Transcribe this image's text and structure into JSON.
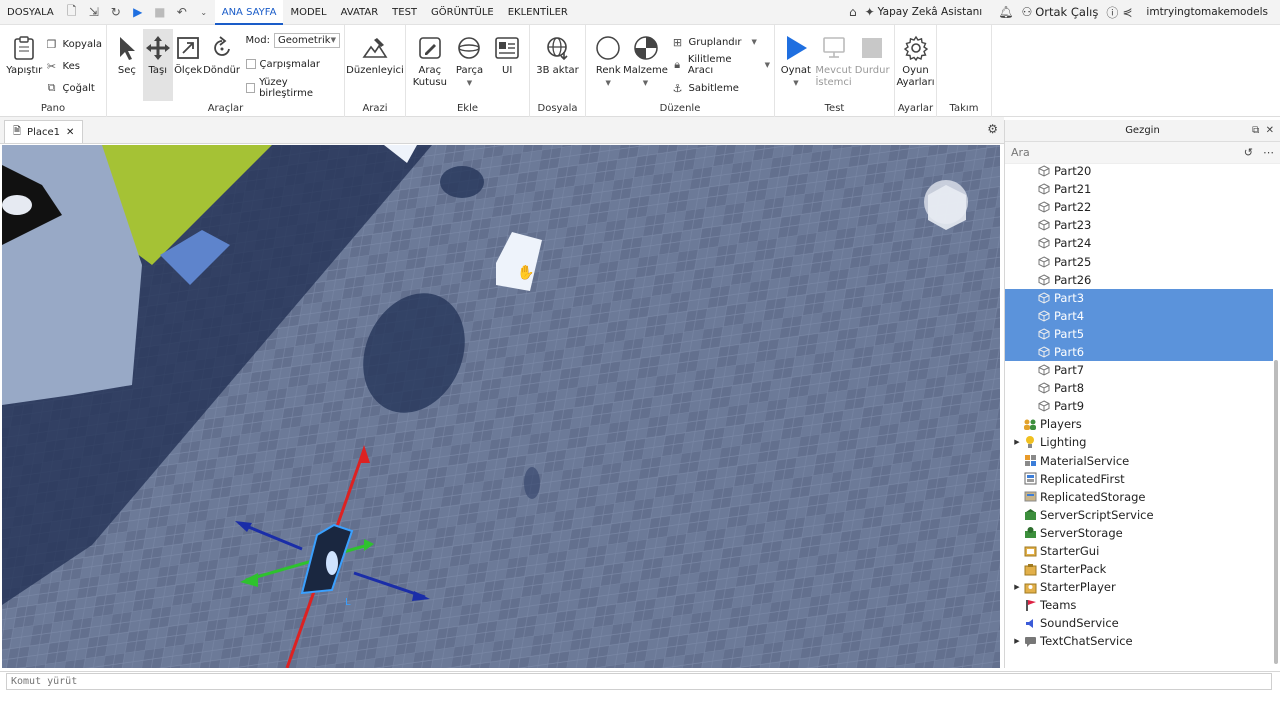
{
  "menu": {
    "file": "DOSYALA",
    "tabs": [
      "ANA SAYFA",
      "MODEL",
      "AVATAR",
      "TEST",
      "GÖRÜNTÜLE",
      "EKLENTİLER"
    ],
    "active_tab": "ANA SAYFA",
    "ai_assistant": "Yapay Zekâ Asistanı",
    "collaborate": "Ortak Çalış",
    "user": "imtryingtomakemodels"
  },
  "ribbon": {
    "pano": {
      "label": "Pano",
      "paste": "Yapıştır",
      "copy": "Kopyala",
      "cut": "Kes",
      "duplicate": "Çoğalt"
    },
    "tools": {
      "label": "Araçlar",
      "select": "Seç",
      "move": "Taşı",
      "scale": "Ölçek",
      "rotate": "Döndür",
      "mode_label": "Mod:",
      "mode_value": "Geometrik",
      "collisions": "Çarpışmalar",
      "surface_join": "Yüzey birleştirme"
    },
    "arazi": {
      "label": "Arazi",
      "editor": "Düzenleyici"
    },
    "insert": {
      "label": "Ekle",
      "toolbox": "Araç Kutusu",
      "part": "Parça",
      "ui": "UI"
    },
    "file": {
      "label": "Dosyala",
      "import3d": "3B aktar"
    },
    "edit": {
      "label": "Düzenle",
      "color": "Renk",
      "material": "Malzeme",
      "group": "Gruplandır",
      "lock_tool": "Kilitleme Aracı",
      "anchor": "Sabitleme"
    },
    "test": {
      "label": "Test",
      "play": "Oynat",
      "current_client": "Mevcut İstemci",
      "stop": "Durdur"
    },
    "settings": {
      "label": "Ayarlar",
      "game_settings": "Oyun Ayarları"
    },
    "team_test": {
      "label": "Takım Testi"
    }
  },
  "document_tab": {
    "label": "Place1"
  },
  "explorer": {
    "title": "Gezgin",
    "search_placeholder": "Ara",
    "items": [
      {
        "name": "Part20",
        "type": "part",
        "indent": 1,
        "selected": false,
        "expandable": false
      },
      {
        "name": "Part21",
        "type": "part",
        "indent": 1,
        "selected": false,
        "expandable": false
      },
      {
        "name": "Part22",
        "type": "part",
        "indent": 1,
        "selected": false,
        "expandable": false
      },
      {
        "name": "Part23",
        "type": "part",
        "indent": 1,
        "selected": false,
        "expandable": false
      },
      {
        "name": "Part24",
        "type": "part",
        "indent": 1,
        "selected": false,
        "expandable": false
      },
      {
        "name": "Part25",
        "type": "part",
        "indent": 1,
        "selected": false,
        "expandable": false
      },
      {
        "name": "Part26",
        "type": "part",
        "indent": 1,
        "selected": false,
        "expandable": false
      },
      {
        "name": "Part3",
        "type": "part",
        "indent": 1,
        "selected": true,
        "expandable": false
      },
      {
        "name": "Part4",
        "type": "part",
        "indent": 1,
        "selected": true,
        "expandable": false
      },
      {
        "name": "Part5",
        "type": "part",
        "indent": 1,
        "selected": true,
        "expandable": false
      },
      {
        "name": "Part6",
        "type": "part",
        "indent": 1,
        "selected": true,
        "expandable": false
      },
      {
        "name": "Part7",
        "type": "part",
        "indent": 1,
        "selected": false,
        "expandable": false
      },
      {
        "name": "Part8",
        "type": "part",
        "indent": 1,
        "selected": false,
        "expandable": false
      },
      {
        "name": "Part9",
        "type": "part",
        "indent": 1,
        "selected": false,
        "expandable": false
      },
      {
        "name": "Players",
        "type": "players",
        "indent": 0,
        "selected": false,
        "expandable": false
      },
      {
        "name": "Lighting",
        "type": "lighting",
        "indent": 0,
        "selected": false,
        "expandable": true
      },
      {
        "name": "MaterialService",
        "type": "material",
        "indent": 0,
        "selected": false,
        "expandable": false
      },
      {
        "name": "ReplicatedFirst",
        "type": "replicated-first",
        "indent": 0,
        "selected": false,
        "expandable": false
      },
      {
        "name": "ReplicatedStorage",
        "type": "replicated-storage",
        "indent": 0,
        "selected": false,
        "expandable": false
      },
      {
        "name": "ServerScriptService",
        "type": "server-script",
        "indent": 0,
        "selected": false,
        "expandable": false
      },
      {
        "name": "ServerStorage",
        "type": "server-storage",
        "indent": 0,
        "selected": false,
        "expandable": false
      },
      {
        "name": "StarterGui",
        "type": "starter-gui",
        "indent": 0,
        "selected": false,
        "expandable": false
      },
      {
        "name": "StarterPack",
        "type": "starter-pack",
        "indent": 0,
        "selected": false,
        "expandable": false
      },
      {
        "name": "StarterPlayer",
        "type": "starter-player",
        "indent": 0,
        "selected": false,
        "expandable": true
      },
      {
        "name": "Teams",
        "type": "teams",
        "indent": 0,
        "selected": false,
        "expandable": false
      },
      {
        "name": "SoundService",
        "type": "sound",
        "indent": 0,
        "selected": false,
        "expandable": false
      },
      {
        "name": "TextChatService",
        "type": "text-chat",
        "indent": 0,
        "selected": false,
        "expandable": true
      }
    ]
  },
  "command_bar": {
    "placeholder": "Komut yürüt"
  },
  "colors": {
    "accent": "#1a5cc8",
    "selection": "#5b93db",
    "play": "#1f6fe0"
  }
}
